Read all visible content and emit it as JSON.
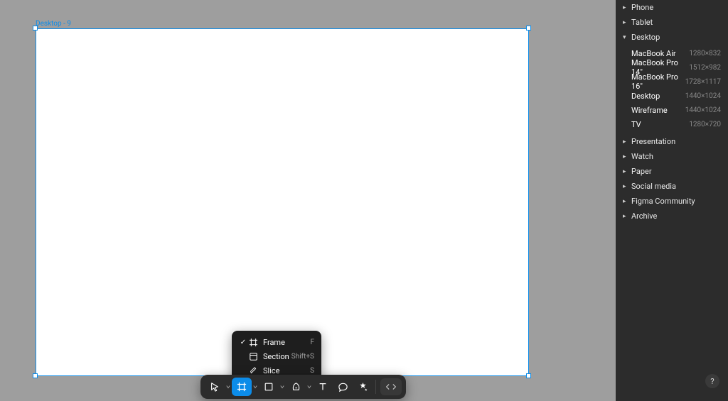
{
  "canvas": {
    "frame_label": "Desktop - 9"
  },
  "flyout": {
    "items": [
      {
        "label": "Frame",
        "shortcut": "F",
        "checked": true
      },
      {
        "label": "Section",
        "shortcut": "Shift+S",
        "checked": false
      },
      {
        "label": "Slice",
        "shortcut": "S",
        "checked": false
      }
    ]
  },
  "panel": {
    "categories": [
      {
        "label": "Phone",
        "expanded": false,
        "items": []
      },
      {
        "label": "Tablet",
        "expanded": false,
        "items": []
      },
      {
        "label": "Desktop",
        "expanded": true,
        "items": [
          {
            "label": "MacBook Air",
            "dim": "1280×832"
          },
          {
            "label": "MacBook Pro 14\"",
            "dim": "1512×982"
          },
          {
            "label": "MacBook Pro 16\"",
            "dim": "1728×1117"
          },
          {
            "label": "Desktop",
            "dim": "1440×1024"
          },
          {
            "label": "Wireframe",
            "dim": "1440×1024"
          },
          {
            "label": "TV",
            "dim": "1280×720"
          }
        ]
      },
      {
        "label": "Presentation",
        "expanded": false,
        "items": []
      },
      {
        "label": "Watch",
        "expanded": false,
        "items": []
      },
      {
        "label": "Paper",
        "expanded": false,
        "items": []
      },
      {
        "label": "Social media",
        "expanded": false,
        "items": []
      },
      {
        "label": "Figma Community",
        "expanded": false,
        "items": []
      },
      {
        "label": "Archive",
        "expanded": false,
        "items": []
      }
    ]
  },
  "help": {
    "label": "?"
  }
}
